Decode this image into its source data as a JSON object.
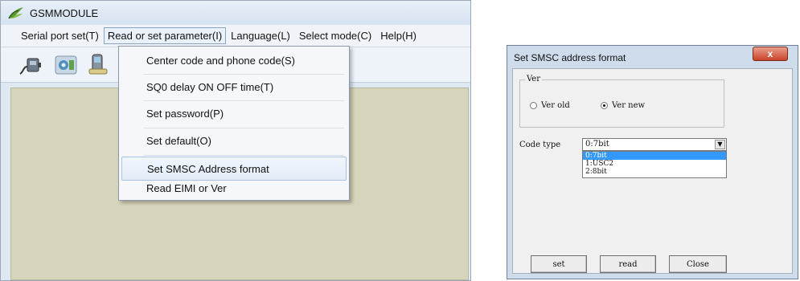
{
  "main_window": {
    "title": "GSMMODULE",
    "menu": [
      {
        "label": "Serial port set(T)",
        "open": false
      },
      {
        "label": "Read or set parameter(I)",
        "open": true
      },
      {
        "label": "Language(L)",
        "open": false
      },
      {
        "label": "Select mode(C)",
        "open": false
      },
      {
        "label": "Help(H)",
        "open": false
      }
    ],
    "toolbar": [
      "serial-connect-icon",
      "module-settings-icon",
      "phone-icon"
    ],
    "dropdown": [
      {
        "label": "Center code and phone code(S)",
        "highlighted": false
      },
      {
        "label": "SQ0 delay ON OFF time(T)",
        "highlighted": false
      },
      {
        "label": "Set password(P)",
        "highlighted": false
      },
      {
        "label": "Set default(O)",
        "highlighted": false
      },
      {
        "label": "Set SMSC Address format",
        "highlighted": true
      },
      {
        "label": "Read EIMI or Ver",
        "highlighted": false
      }
    ]
  },
  "dialog": {
    "title": "Set SMSC address format",
    "close_glyph": "x",
    "ver_group_label": "Ver",
    "radio_old": {
      "label": "Ver old",
      "checked": false
    },
    "radio_new": {
      "label": "Ver new",
      "checked": true
    },
    "code_type_label": "Code type",
    "code_type_value": "0:7bit",
    "code_type_options": [
      "0:7bit",
      "1:USC2",
      "2:8bit"
    ],
    "selected_option": "0:7bit",
    "buttons": {
      "set": "set",
      "read": "read",
      "close": "Close"
    }
  },
  "colors": {
    "client_area": "#d6d4ba",
    "list_selection": "#3399ff",
    "close_button": "#c9432a"
  }
}
